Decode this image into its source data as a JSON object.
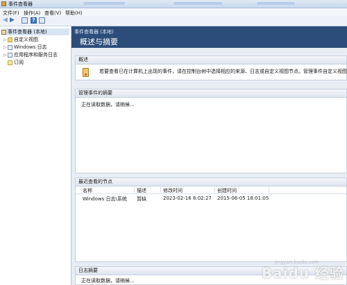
{
  "window": {
    "title": "事件查看器"
  },
  "menu": [
    {
      "label": "文件(F)"
    },
    {
      "label": "操作(A)"
    },
    {
      "label": "查看(V)"
    },
    {
      "label": "帮助(H)"
    }
  ],
  "toolbar": {
    "back_icon": "back-arrow-icon",
    "forward_icon": "forward-arrow-icon",
    "show_hide_icon": "console-tree-icon",
    "help_label": "?",
    "properties_icon": "properties-icon"
  },
  "nav": {
    "root": "事件查看器 (本地)",
    "items": [
      {
        "label": "自定义视图",
        "icon": "folder-icon"
      },
      {
        "label": "Windows 日志",
        "icon": "log-folder-icon"
      },
      {
        "label": "应用程序和服务日志",
        "icon": "log-folder-icon"
      },
      {
        "label": "订阅",
        "icon": "subscription-icon"
      }
    ]
  },
  "content": {
    "breadcrumb": "事件查看器 (本地)",
    "heading": "概述与摘要",
    "overview": {
      "title": "概述",
      "text": "若要查看已在计算机上出现的事件，请在控制台树中选择相应的来源、日志或自定义视图节点。管理事件自定义视图"
    },
    "admin_summary": {
      "title": "管理事件的摘要",
      "status": "正在读取数据，请稍候..."
    },
    "recent_nodes": {
      "title": "最近查看的节点",
      "columns": [
        "名称",
        "描述",
        "修改时间",
        "创建时间"
      ],
      "rows": [
        {
          "name": "Windows 日志\\系统",
          "desc": "暂缺",
          "modified": "2023-02-16 8:02:27",
          "created": "2015-06-05 18:01:05"
        }
      ]
    },
    "log_summary": {
      "title": "日志摘要",
      "status": "正在读取数据，请稍候..."
    }
  },
  "watermark": {
    "brand": "Baidu 经验",
    "url": "jingyan.baidu.com"
  }
}
